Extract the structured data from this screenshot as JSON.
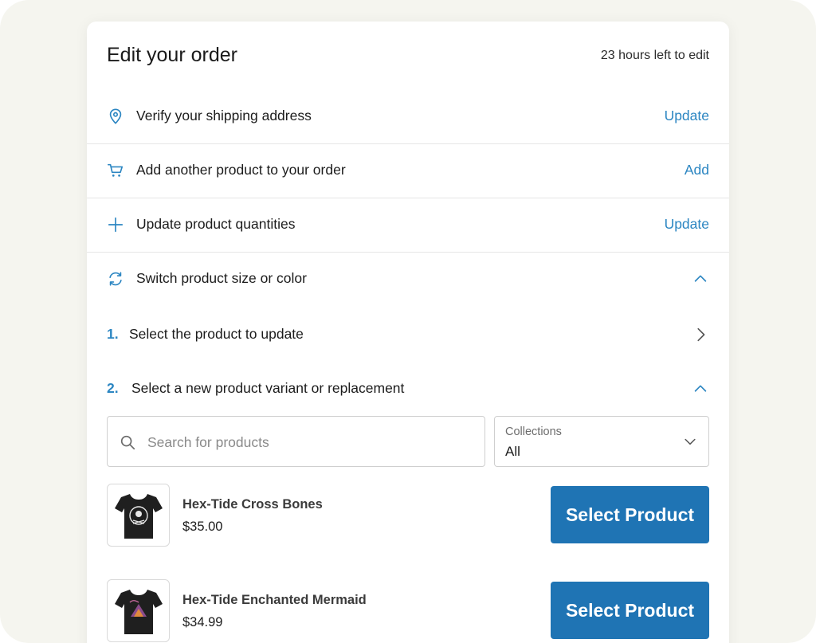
{
  "header": {
    "title": "Edit your order",
    "time_left": "23 hours left to edit"
  },
  "actions": [
    {
      "icon": "location-pin-icon",
      "label": "Verify your shipping address",
      "action": "Update"
    },
    {
      "icon": "cart-icon",
      "label": "Add another product to your order",
      "action": "Add"
    },
    {
      "icon": "plus-icon",
      "label": "Update product quantities",
      "action": "Update"
    },
    {
      "icon": "refresh-icon",
      "label": "Switch product size or color",
      "expanded": true
    }
  ],
  "steps": [
    {
      "number": "1.",
      "label": "Select the product to update",
      "state": "collapsed"
    },
    {
      "number": "2.",
      "label": "Select a new product variant or replacement",
      "state": "expanded"
    }
  ],
  "search": {
    "placeholder": "Search for products",
    "value": ""
  },
  "collections": {
    "label": "Collections",
    "selected": "All"
  },
  "products": [
    {
      "name": "Hex-Tide Cross Bones",
      "price": "$35.00",
      "button": "Select Product"
    },
    {
      "name": "Hex-Tide Enchanted Mermaid",
      "price": "$34.99",
      "button": "Select Product"
    }
  ],
  "colors": {
    "accent": "#2c86c2",
    "button": "#1f74b4",
    "background": "#f5f5ef",
    "card": "#ffffff"
  }
}
